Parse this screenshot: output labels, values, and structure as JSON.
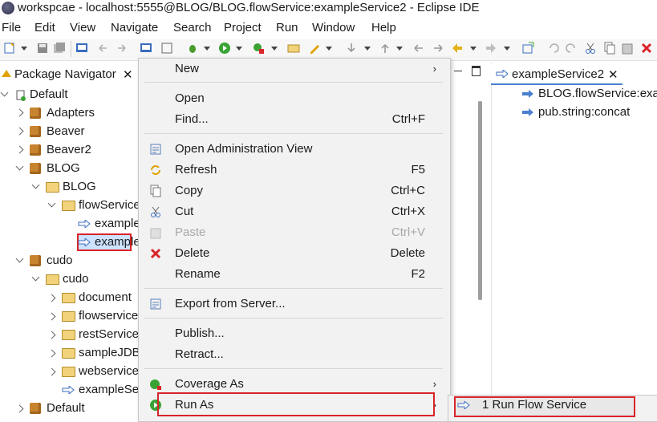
{
  "window": {
    "title": "workspcae - localhost:5555@BLOG/BLOG.flowService:exampleService2 - Eclipse IDE"
  },
  "menubar": [
    "File",
    "Edit",
    "View",
    "Navigate",
    "Search",
    "Project",
    "Run",
    "Window",
    "Help"
  ],
  "navigator": {
    "tab_title": "Package Navigator",
    "tree": [
      {
        "label": "Default"
      },
      {
        "label": "Adapters"
      },
      {
        "label": "Beaver"
      },
      {
        "label": "Beaver2"
      },
      {
        "label": "BLOG"
      },
      {
        "label": "BLOG"
      },
      {
        "label": "flowService"
      },
      {
        "label": "example"
      },
      {
        "label": "example"
      },
      {
        "label": "cudo"
      },
      {
        "label": "cudo"
      },
      {
        "label": "document"
      },
      {
        "label": "flowservice"
      },
      {
        "label": "restService"
      },
      {
        "label": "sampleJDB"
      },
      {
        "label": "webservice"
      },
      {
        "label": "exampleSe"
      },
      {
        "label": "Default"
      }
    ]
  },
  "editor": {
    "tab_title": "exampleService2",
    "items": [
      "BLOG.flowService:exar",
      "pub.string:concat"
    ]
  },
  "context_menu": {
    "items": [
      {
        "label": "New",
        "shortcut": "",
        "submenu": true
      },
      {
        "label": "Open",
        "shortcut": ""
      },
      {
        "label": "Find...",
        "shortcut": "Ctrl+F"
      },
      {
        "label": "Open Administration View",
        "shortcut": ""
      },
      {
        "label": "Refresh",
        "shortcut": "F5"
      },
      {
        "label": "Copy",
        "shortcut": "Ctrl+C"
      },
      {
        "label": "Cut",
        "shortcut": "Ctrl+X"
      },
      {
        "label": "Paste",
        "shortcut": "Ctrl+V",
        "disabled": true
      },
      {
        "label": "Delete",
        "shortcut": "Delete"
      },
      {
        "label": "Rename",
        "shortcut": "F2"
      },
      {
        "label": "Export from Server...",
        "shortcut": ""
      },
      {
        "label": "Publish...",
        "shortcut": ""
      },
      {
        "label": "Retract...",
        "shortcut": ""
      },
      {
        "label": "Coverage As",
        "shortcut": "",
        "submenu": true
      },
      {
        "label": "Run As",
        "shortcut": "",
        "submenu": true
      }
    ]
  },
  "submenu": {
    "items": [
      "1 Run Flow Service"
    ]
  },
  "colors": {
    "highlight_red": "#d9242a",
    "selection_blue": "#cce2ff",
    "accent_blue": "#4a7fd0"
  }
}
